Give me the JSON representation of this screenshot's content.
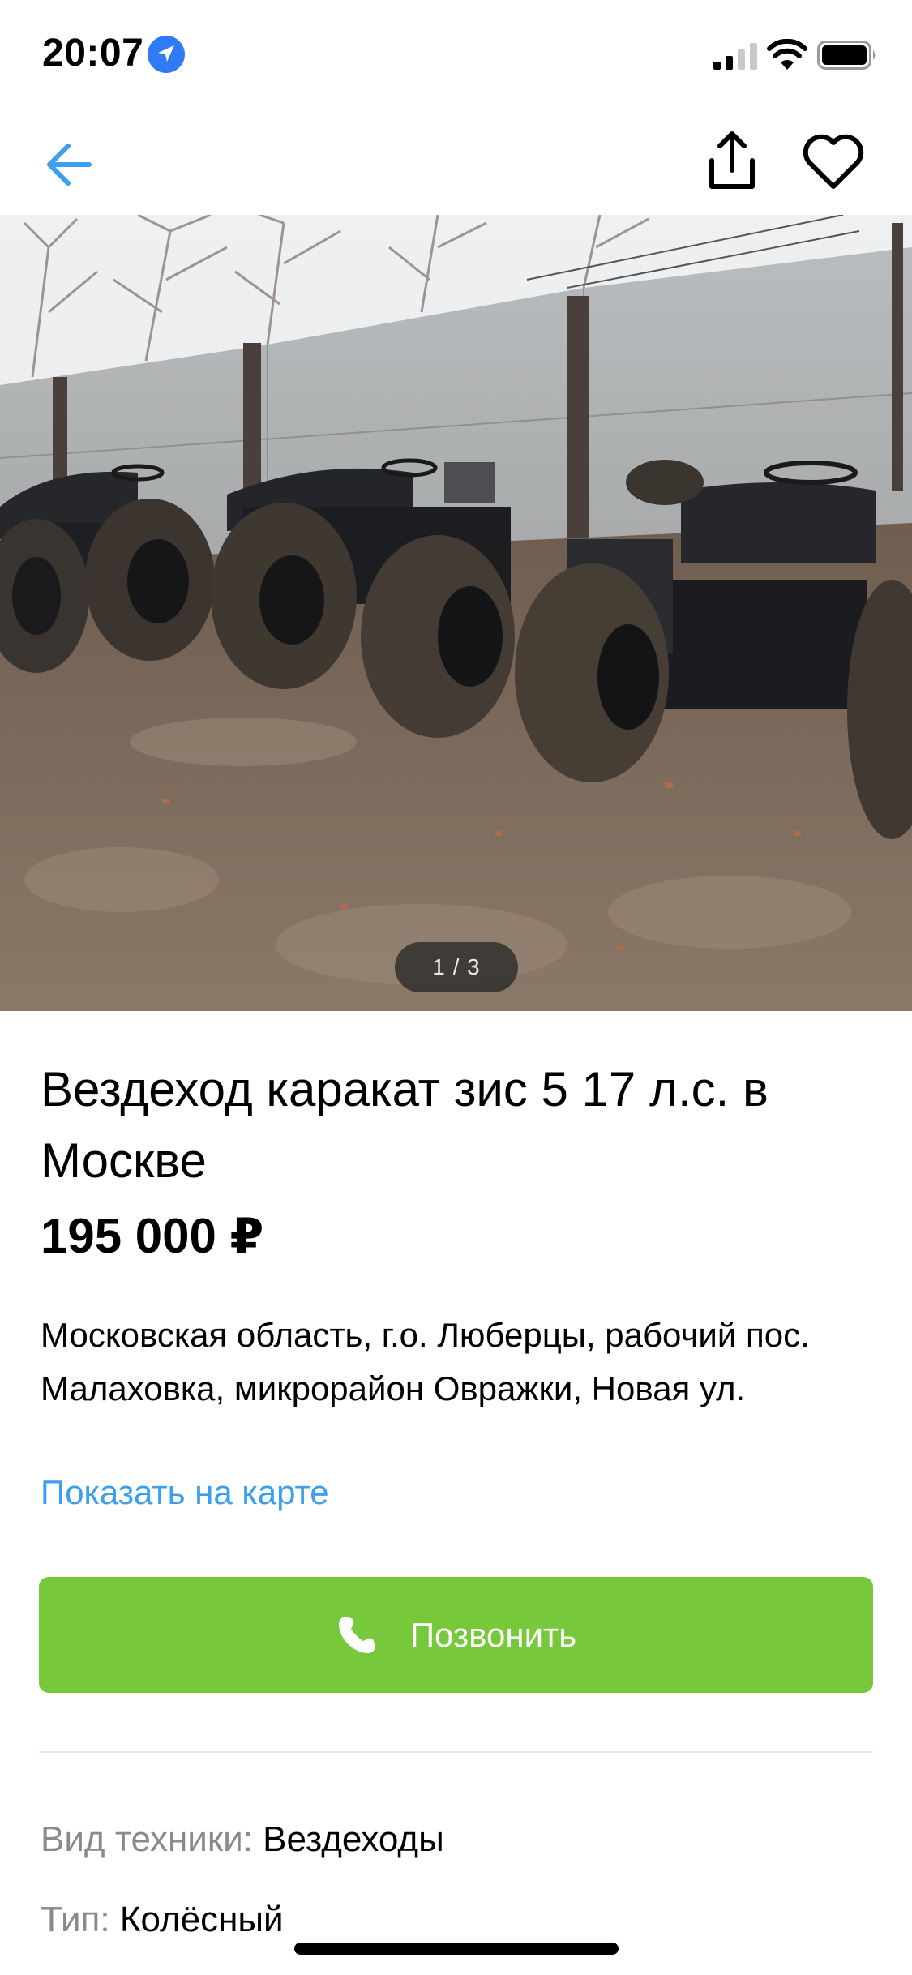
{
  "status_bar": {
    "time": "20:07"
  },
  "nav": {
    "icons": [
      "arrow-left-icon",
      "share-icon",
      "heart-icon"
    ],
    "accent_color": "#3c9fed"
  },
  "listing": {
    "photo_counter": "1 / 3",
    "title": "Вездеход каракат зис 5 17 л.с. в Москве",
    "price": "195 000 ₽",
    "address": "Московская область, г.о. Люберцы, рабочий пос. Малаховка, микрорайон Овражки, Новая ул.",
    "map_link": "Показать на карте",
    "call_button": "Позвонить",
    "call_button_color": "#77c83a"
  },
  "params": [
    {
      "key": "Вид техники:",
      "value": "Вездеходы"
    },
    {
      "key": "Тип:",
      "value": "Колёсный"
    }
  ]
}
